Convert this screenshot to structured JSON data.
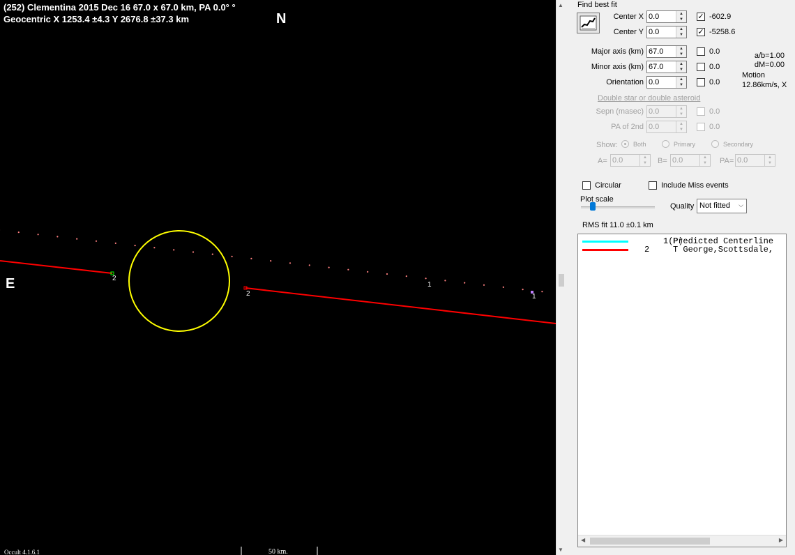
{
  "plot": {
    "title_line1": "(252) Clementina  2015 Dec 16   67.0 x 67.0 km,  PA 0.0° °",
    "title_line2": "Geocentric  X  1253.4 ±4.3  Y 2676.8 ±37.3 km",
    "north_label": "N",
    "east_label": "E",
    "chord_labels": [
      "2",
      "2",
      "1",
      "1"
    ],
    "version": "Occult 4.1.6.1",
    "scale_label": "50 km.",
    "colors": {
      "background": "#000000",
      "ellipse": "#ffff00",
      "chord": "#ff0000",
      "predicted_track": "#ff8080"
    }
  },
  "panel": {
    "find_best_fit": "Find best fit",
    "fit_icon": "chart-fit-icon",
    "center_x": {
      "label": "Center X",
      "value": "0.0",
      "checked": true,
      "fit": "-602.9"
    },
    "center_y": {
      "label": "Center Y",
      "value": "0.0",
      "checked": true,
      "fit": "-5258.6"
    },
    "major_axis": {
      "label": "Major axis (km)",
      "value": "67.0",
      "checked": false,
      "fit": "0.0"
    },
    "minor_axis": {
      "label": "Minor axis (km)",
      "value": "67.0",
      "checked": false,
      "fit": "0.0"
    },
    "orientation": {
      "label": "Orientation",
      "value": "0.0",
      "checked": false,
      "fit": "0.0"
    },
    "ab_ratio": "a/b=1.00",
    "dm": "dM=0.00",
    "motion_label": "Motion",
    "motion_value": "12.86km/s, X",
    "double_star": "Double star  or  double asteroid",
    "sepn": {
      "label": "Sepn (masec)",
      "value": "0.0",
      "fit": "0.0"
    },
    "pa_2nd": {
      "label": "PA of 2nd",
      "value": "0.0",
      "fit": "0.0"
    },
    "show_label": "Show:",
    "show_options": [
      "Both",
      "Primary",
      "Secondary"
    ],
    "a_label": "A=",
    "a_value": "0.0",
    "b_label": "B=",
    "b_value": "0.0",
    "pa_label": "PA=",
    "pa_value": "0.0",
    "circular": "Circular",
    "include_miss": "Include Miss events",
    "plot_scale": "Plot scale",
    "quality_label": "Quality",
    "quality_value": "Not fitted",
    "rms_fit": "RMS fit 11.0 ±0.1 km",
    "legend": [
      {
        "num": "1(P)",
        "name": "Predicted Centerline",
        "color": "#00ffff"
      },
      {
        "num": "2",
        "name": "T George,Scottsdale,",
        "color": "#ff0000"
      }
    ]
  }
}
